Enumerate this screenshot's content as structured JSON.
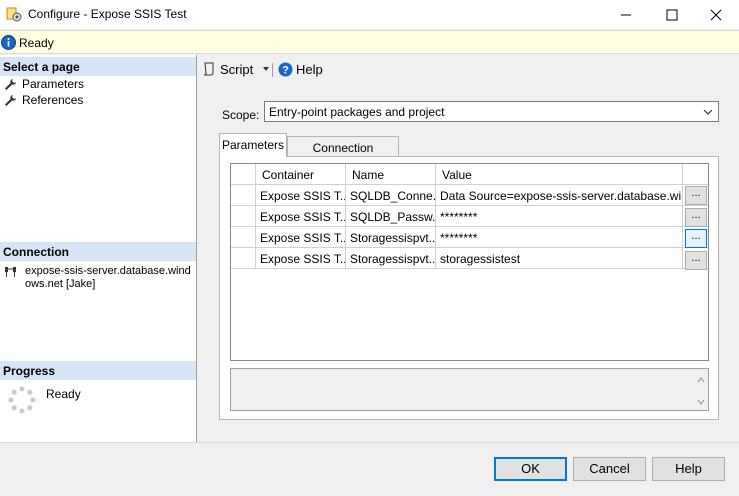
{
  "window": {
    "title": "Configure - Expose SSIS Test",
    "minimize_icon": "minimize-icon",
    "maximize_icon": "maximize-icon",
    "close_icon": "close-icon"
  },
  "status": {
    "icon": "info-icon",
    "text": "Ready"
  },
  "left_panel": {
    "select_page_header": "Select a page",
    "pages": [
      {
        "label": "Parameters",
        "icon": "wrench-icon"
      },
      {
        "label": "References",
        "icon": "wrench-icon"
      }
    ],
    "connection_header": "Connection",
    "connection_icon": "connection-icon",
    "connection_line1": "expose-ssis-server.database.wind",
    "connection_line2": "ows.net [Jake]",
    "progress_header": "Progress",
    "progress_icon": "spinner-icon",
    "progress_text": "Ready"
  },
  "toolbar": {
    "script_label": "Script",
    "help_label": "Help"
  },
  "scope": {
    "label": "Scope:",
    "value": "Entry-point packages and project"
  },
  "tabs": [
    {
      "label": "Parameters",
      "active": true
    },
    {
      "label": "Connection Managers",
      "active": false
    }
  ],
  "grid": {
    "columns": [
      "Container",
      "Name",
      "Value"
    ],
    "rows": [
      {
        "container": "Expose SSIS T...",
        "name": "SQLDB_Conne...",
        "value": "Data Source=expose-ssis-server.database.windo..."
      },
      {
        "container": "Expose SSIS T...",
        "name": "SQLDB_Passw...",
        "value": "********"
      },
      {
        "container": "Expose SSIS T...",
        "name": "Storagessispvt...",
        "value": "********"
      },
      {
        "container": "Expose SSIS T...",
        "name": "Storagessispvt...",
        "value": "storagessistest"
      }
    ],
    "ellipsis": "..."
  },
  "buttons": {
    "ok": "OK",
    "cancel": "Cancel",
    "help": "Help"
  },
  "colors": {
    "section_header_bg": "#d6e5f5",
    "status_bg": "#ffffe1",
    "accent": "#0078d7"
  }
}
